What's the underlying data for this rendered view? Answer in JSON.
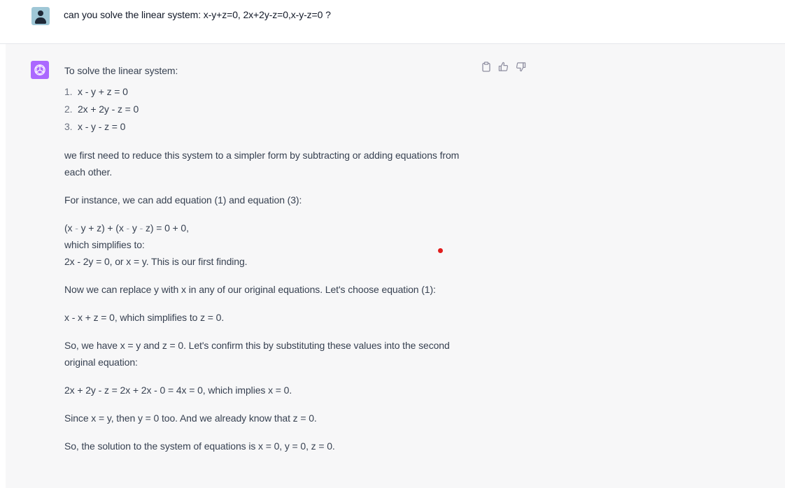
{
  "user": {
    "avatar_icon": "user-avatar-icon",
    "message": "can you solve the linear system: x-y+z=0, 2x+2y-z=0,x-y-z=0 ?"
  },
  "assistant": {
    "avatar_icon": "openai-logo-icon",
    "actions": [
      "clipboard-icon",
      "thumbs-up-icon",
      "thumbs-down-icon"
    ],
    "intro": "To solve the linear system:",
    "equations": [
      {
        "num": "1.",
        "text": "x - y + z = 0"
      },
      {
        "num": "2.",
        "text": "2x + 2y - z = 0"
      },
      {
        "num": "3.",
        "text": "x - y - z = 0"
      }
    ],
    "p1": "we first need to reduce this system to a simpler form by subtracting or adding equations from each other.",
    "p2": "For instance, we can add equation (1) and equation (3):",
    "calc_line1_a": "(x ",
    "calc_line1_op1": "-",
    "calc_line1_b": " y + z) + (x ",
    "calc_line1_op2": "-",
    "calc_line1_c": " y ",
    "calc_line1_op3": "-",
    "calc_line1_d": " z) = 0 + 0,",
    "calc_line2": "which simplifies to:",
    "calc_line3": "2x - 2y = 0, or x = y. This is our first finding.",
    "p3": "Now we can replace y with x in any of our original equations. Let's choose equation (1):",
    "p4": "x - x + z = 0, which simplifies to z = 0.",
    "p5": "So, we have x = y and z = 0. Let's confirm this by substituting these values into the second original equation:",
    "p6": "2x + 2y - z = 2x + 2x - 0 = 4x = 0, which implies x = 0.",
    "p7": "Since x = y, then y = 0 too. And we already know that z = 0.",
    "p8": "So, the solution to the system of equations is x = 0, y = 0, z = 0."
  },
  "colors": {
    "assistant_bg": "#f7f7f8",
    "gpt_avatar": "#ab68ff",
    "cursor_dot": "#e11d1d"
  }
}
